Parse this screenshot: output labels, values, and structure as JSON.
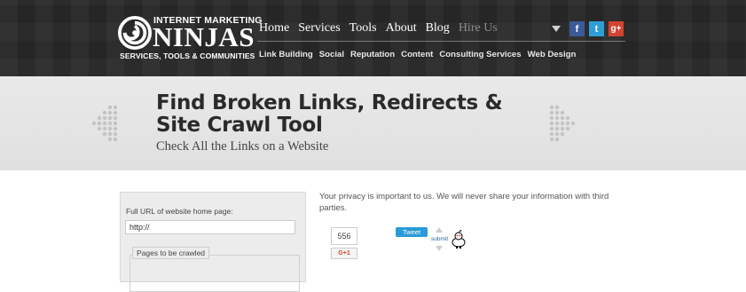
{
  "logo": {
    "top_text": "INTERNET MARKETING",
    "main_text": "NINJAS",
    "bottom_text": "SERVICES, TOOLS & COMMUNITIES"
  },
  "main_nav": [
    "Home",
    "Services",
    "Tools",
    "About",
    "Blog",
    "Hire Us"
  ],
  "sub_nav": [
    "Link Building",
    "Social",
    "Reputation",
    "Content",
    "Consulting Services",
    "Web Design"
  ],
  "social": {
    "facebook": "f",
    "twitter": "t",
    "google_plus": "g+"
  },
  "banner": {
    "title_line1": "Find Broken Links, Redirects &",
    "title_line2": "Site Crawl Tool",
    "subtitle": "Check All the Links on a Website"
  },
  "form": {
    "url_label": "Full URL of website home page:",
    "url_value": "http://",
    "pages_legend": "Pages to be crawled"
  },
  "privacy_text": "Your privacy is important to us. We will never share your information with third parties.",
  "share": {
    "count": "556",
    "gplus_label": "G+1",
    "tweet_label": "Tweet",
    "reddit_label": "submit"
  },
  "colors": {
    "header_bg": "#262626",
    "facebook": "#3b5a98",
    "twitter": "#2e9fd6",
    "google_plus": "#d2442f"
  }
}
